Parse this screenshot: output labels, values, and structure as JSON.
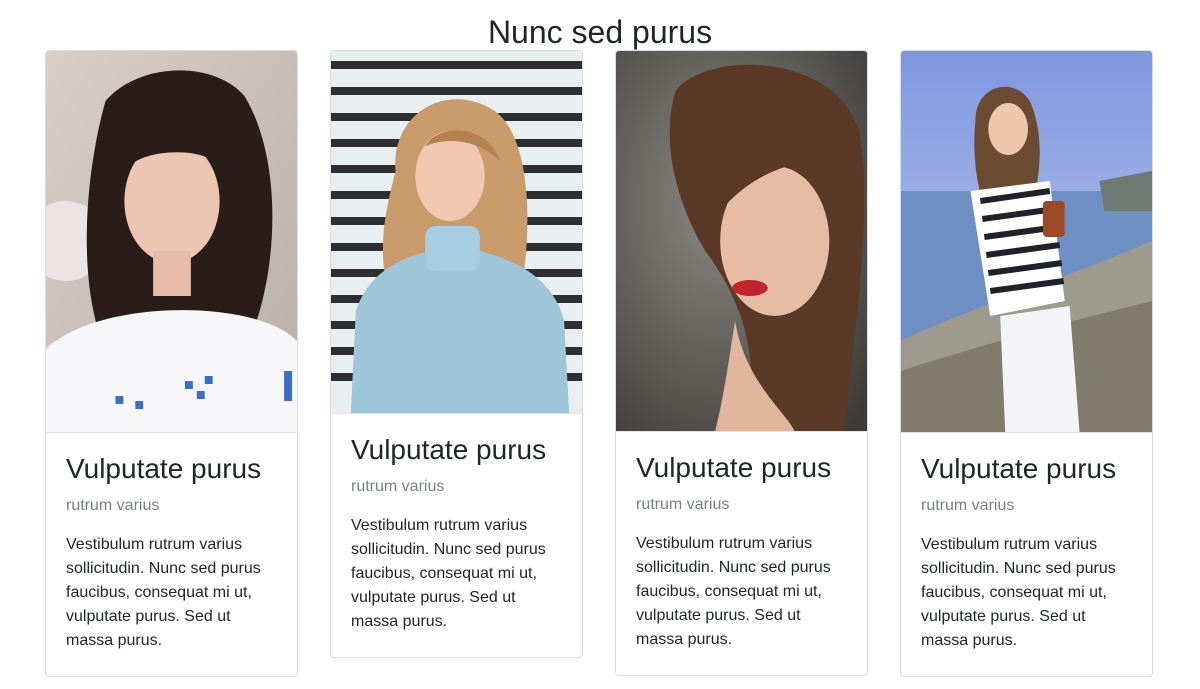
{
  "page": {
    "title": "Nunc sed purus"
  },
  "cards": [
    {
      "title": "Vulputate purus",
      "subtitle": "rutrum varius",
      "text": "Vestibulum rutrum varius sollicitudin. Nunc sed purus faucibus, consequat mi ut, vulputate purus. Sed ut massa purus."
    },
    {
      "title": "Vulputate purus",
      "subtitle": "rutrum varius",
      "text": "Vestibulum rutrum varius sollicitudin. Nunc sed purus faucibus, consequat mi ut, vulputate purus. Sed ut massa purus."
    },
    {
      "title": "Vulputate purus",
      "subtitle": "rutrum varius",
      "text": "Vestibulum rutrum varius sollicitudin. Nunc sed purus faucibus, consequat mi ut, vulputate purus. Sed ut massa purus."
    },
    {
      "title": "Vulputate purus",
      "subtitle": "rutrum varius",
      "text": "Vestibulum rutrum varius sollicitudin. Nunc sed purus faucibus, consequat mi ut, vulputate purus. Sed ut massa purus."
    }
  ],
  "colors": {
    "text": "#212529",
    "muted": "#7a7f85",
    "border": "#dcdcdc"
  }
}
